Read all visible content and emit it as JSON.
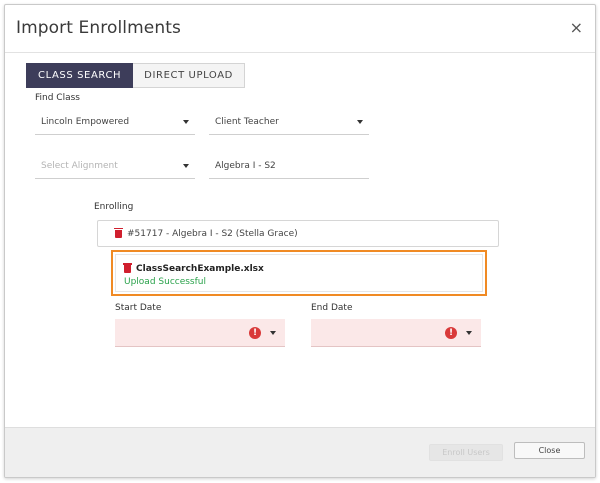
{
  "modal": {
    "title": "Import Enrollments",
    "close_glyph": "×"
  },
  "tabs": [
    {
      "label": "CLASS SEARCH",
      "active": true
    },
    {
      "label": "DIRECT UPLOAD",
      "active": false
    }
  ],
  "find_class": {
    "label": "Find Class",
    "school_value": "Lincoln Empowered",
    "teacher_value": "Client Teacher",
    "alignment_placeholder": "Select Alignment",
    "course_value": "Algebra I - S2"
  },
  "enrolling": {
    "label": "Enrolling",
    "class_entry": "#51717 - Algebra I - S2 (Stella Grace)"
  },
  "upload": {
    "file_name": "ClassSearchExample.xlsx",
    "status": "Upload Successful"
  },
  "dates": {
    "start_label": "Start Date",
    "end_label": "End Date",
    "alert_glyph": "!"
  },
  "footer": {
    "enroll_label": "Enroll Users",
    "close_label": "Close"
  },
  "colors": {
    "tab_active": "#3d3d5a",
    "highlight": "#f08a24",
    "success": "#2aa24b",
    "error_bg": "#fbe8e8",
    "trash": "#d01f2e"
  }
}
